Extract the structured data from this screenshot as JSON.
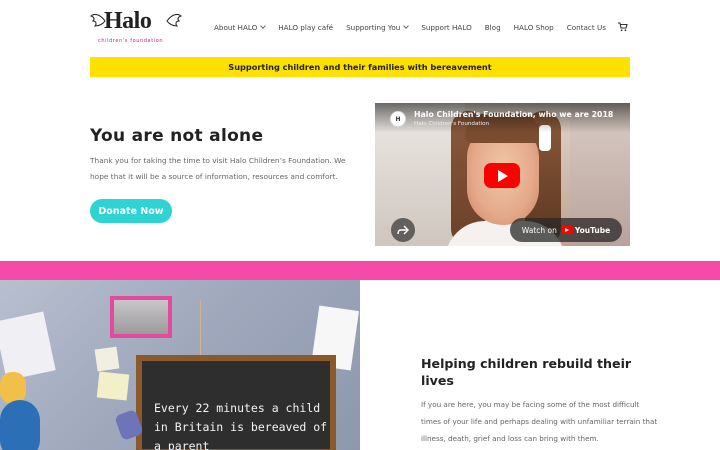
{
  "header": {
    "logo_text": "Halo",
    "logo_tagline": "children's foundation",
    "nav": [
      {
        "label": "About HALO",
        "dropdown": true
      },
      {
        "label": "HALO play café",
        "dropdown": false
      },
      {
        "label": "Supporting You",
        "dropdown": true
      },
      {
        "label": "Support HALO",
        "dropdown": false
      },
      {
        "label": "Blog",
        "dropdown": false
      },
      {
        "label": "HALO Shop",
        "dropdown": false
      },
      {
        "label": "Contact Us",
        "dropdown": false
      }
    ],
    "cart_icon": "cart-icon"
  },
  "banner": {
    "text": "Supporting children and their families with bereavement",
    "color": "#ffe000"
  },
  "hero": {
    "title": "You are not alone",
    "text": "Thank you for taking the time to visit Halo Children’s Foundation. We hope that it will be a source of information, resources and comfort.",
    "donate_label": "Donate Now",
    "donate_color": "#2ed3d3"
  },
  "video": {
    "title": "Halo Children's Foundation, who we are 2018",
    "channel": "Halo Children's Foundation",
    "watch_label": "Watch on",
    "platform": "YouTube"
  },
  "accent": {
    "pink": "#f54aa8"
  },
  "section2": {
    "board_line1": "Every 22 minutes a child",
    "board_line2": "in Britain is bereaved of",
    "board_line3": "a parent",
    "heading": "Helping children rebuild their lives",
    "text": "If you are here, you may be facing some of the most difficult times of your life and perhaps dealing with unfamiliar terrain that illness, death, grief and loss can bring with them."
  }
}
